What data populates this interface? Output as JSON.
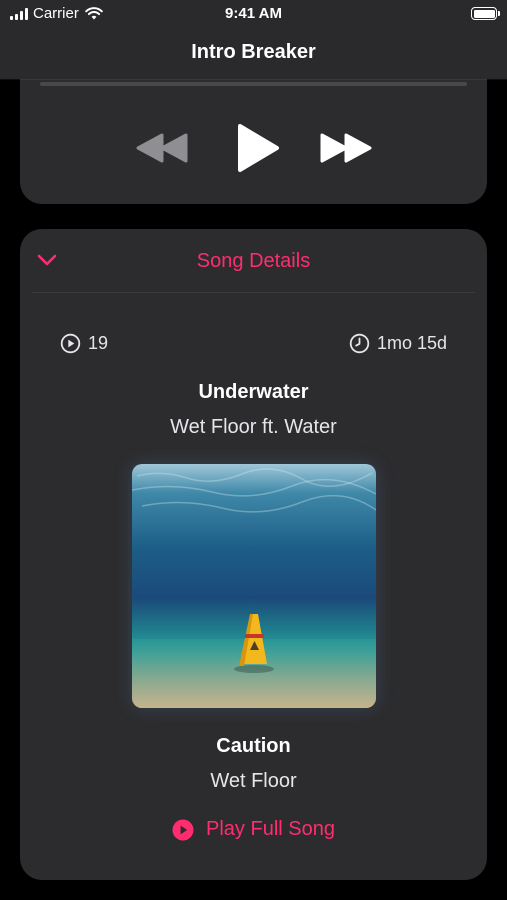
{
  "status_bar": {
    "carrier": "Carrier",
    "time": "9:41 AM"
  },
  "nav": {
    "title": "Intro Breaker"
  },
  "player": {
    "progress": 0,
    "controls": [
      "rewind-icon",
      "play-icon",
      "fast-forward-icon"
    ]
  },
  "details": {
    "header": "Song Details",
    "play_count": "19",
    "age": "1mo 15d",
    "song_title": "Underwater",
    "song_artist": "Wet Floor ft. Water",
    "album_title": "Caution",
    "album_artist": "Wet Floor",
    "play_full_label": "Play Full Song"
  },
  "colors": {
    "accent": "#ff2d6f",
    "card": "#2c2c2e",
    "background": "#000000",
    "bar": "#2a2a2c"
  }
}
